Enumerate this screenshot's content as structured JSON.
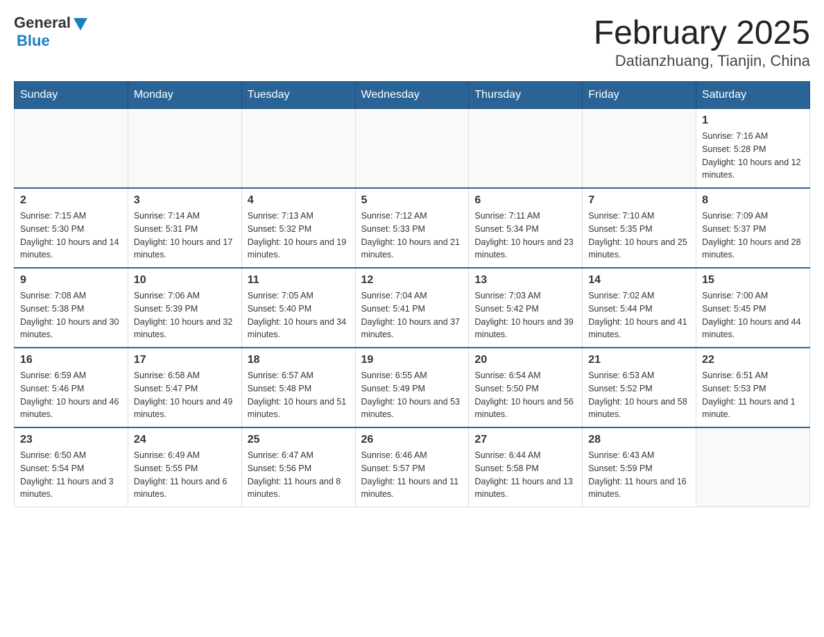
{
  "header": {
    "logo_general": "General",
    "logo_blue": "Blue",
    "month_title": "February 2025",
    "location": "Datianzhuang, Tianjin, China"
  },
  "days_of_week": [
    "Sunday",
    "Monday",
    "Tuesday",
    "Wednesday",
    "Thursday",
    "Friday",
    "Saturday"
  ],
  "weeks": [
    [
      {
        "day": "",
        "info": ""
      },
      {
        "day": "",
        "info": ""
      },
      {
        "day": "",
        "info": ""
      },
      {
        "day": "",
        "info": ""
      },
      {
        "day": "",
        "info": ""
      },
      {
        "day": "",
        "info": ""
      },
      {
        "day": "1",
        "info": "Sunrise: 7:16 AM\nSunset: 5:28 PM\nDaylight: 10 hours and 12 minutes."
      }
    ],
    [
      {
        "day": "2",
        "info": "Sunrise: 7:15 AM\nSunset: 5:30 PM\nDaylight: 10 hours and 14 minutes."
      },
      {
        "day": "3",
        "info": "Sunrise: 7:14 AM\nSunset: 5:31 PM\nDaylight: 10 hours and 17 minutes."
      },
      {
        "day": "4",
        "info": "Sunrise: 7:13 AM\nSunset: 5:32 PM\nDaylight: 10 hours and 19 minutes."
      },
      {
        "day": "5",
        "info": "Sunrise: 7:12 AM\nSunset: 5:33 PM\nDaylight: 10 hours and 21 minutes."
      },
      {
        "day": "6",
        "info": "Sunrise: 7:11 AM\nSunset: 5:34 PM\nDaylight: 10 hours and 23 minutes."
      },
      {
        "day": "7",
        "info": "Sunrise: 7:10 AM\nSunset: 5:35 PM\nDaylight: 10 hours and 25 minutes."
      },
      {
        "day": "8",
        "info": "Sunrise: 7:09 AM\nSunset: 5:37 PM\nDaylight: 10 hours and 28 minutes."
      }
    ],
    [
      {
        "day": "9",
        "info": "Sunrise: 7:08 AM\nSunset: 5:38 PM\nDaylight: 10 hours and 30 minutes."
      },
      {
        "day": "10",
        "info": "Sunrise: 7:06 AM\nSunset: 5:39 PM\nDaylight: 10 hours and 32 minutes."
      },
      {
        "day": "11",
        "info": "Sunrise: 7:05 AM\nSunset: 5:40 PM\nDaylight: 10 hours and 34 minutes."
      },
      {
        "day": "12",
        "info": "Sunrise: 7:04 AM\nSunset: 5:41 PM\nDaylight: 10 hours and 37 minutes."
      },
      {
        "day": "13",
        "info": "Sunrise: 7:03 AM\nSunset: 5:42 PM\nDaylight: 10 hours and 39 minutes."
      },
      {
        "day": "14",
        "info": "Sunrise: 7:02 AM\nSunset: 5:44 PM\nDaylight: 10 hours and 41 minutes."
      },
      {
        "day": "15",
        "info": "Sunrise: 7:00 AM\nSunset: 5:45 PM\nDaylight: 10 hours and 44 minutes."
      }
    ],
    [
      {
        "day": "16",
        "info": "Sunrise: 6:59 AM\nSunset: 5:46 PM\nDaylight: 10 hours and 46 minutes."
      },
      {
        "day": "17",
        "info": "Sunrise: 6:58 AM\nSunset: 5:47 PM\nDaylight: 10 hours and 49 minutes."
      },
      {
        "day": "18",
        "info": "Sunrise: 6:57 AM\nSunset: 5:48 PM\nDaylight: 10 hours and 51 minutes."
      },
      {
        "day": "19",
        "info": "Sunrise: 6:55 AM\nSunset: 5:49 PM\nDaylight: 10 hours and 53 minutes."
      },
      {
        "day": "20",
        "info": "Sunrise: 6:54 AM\nSunset: 5:50 PM\nDaylight: 10 hours and 56 minutes."
      },
      {
        "day": "21",
        "info": "Sunrise: 6:53 AM\nSunset: 5:52 PM\nDaylight: 10 hours and 58 minutes."
      },
      {
        "day": "22",
        "info": "Sunrise: 6:51 AM\nSunset: 5:53 PM\nDaylight: 11 hours and 1 minute."
      }
    ],
    [
      {
        "day": "23",
        "info": "Sunrise: 6:50 AM\nSunset: 5:54 PM\nDaylight: 11 hours and 3 minutes."
      },
      {
        "day": "24",
        "info": "Sunrise: 6:49 AM\nSunset: 5:55 PM\nDaylight: 11 hours and 6 minutes."
      },
      {
        "day": "25",
        "info": "Sunrise: 6:47 AM\nSunset: 5:56 PM\nDaylight: 11 hours and 8 minutes."
      },
      {
        "day": "26",
        "info": "Sunrise: 6:46 AM\nSunset: 5:57 PM\nDaylight: 11 hours and 11 minutes."
      },
      {
        "day": "27",
        "info": "Sunrise: 6:44 AM\nSunset: 5:58 PM\nDaylight: 11 hours and 13 minutes."
      },
      {
        "day": "28",
        "info": "Sunrise: 6:43 AM\nSunset: 5:59 PM\nDaylight: 11 hours and 16 minutes."
      },
      {
        "day": "",
        "info": ""
      }
    ]
  ]
}
